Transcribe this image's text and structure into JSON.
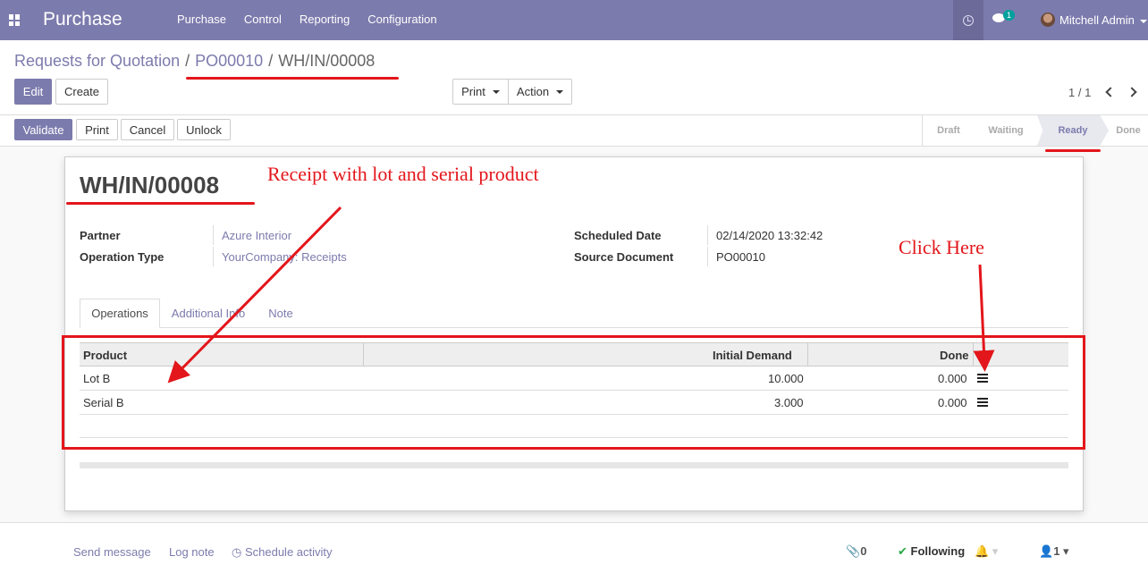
{
  "navbar": {
    "app_name": "Purchase",
    "menu": [
      "Purchase",
      "Control",
      "Reporting",
      "Configuration"
    ],
    "chat_count": "1",
    "user_name": "Mitchell Admin"
  },
  "breadcrumb": {
    "root": "Requests for Quotation",
    "parent": "PO00010",
    "current": "WH/IN/00008"
  },
  "toolbar": {
    "edit": "Edit",
    "create": "Create",
    "print": "Print",
    "action": "Action",
    "pager": "1 / 1"
  },
  "actions": {
    "validate": "Validate",
    "print": "Print",
    "cancel": "Cancel",
    "unlock": "Unlock"
  },
  "stages": [
    "Draft",
    "Waiting",
    "Ready",
    "Done"
  ],
  "current_stage": "Ready",
  "record": {
    "name": "WH/IN/00008",
    "partner_label": "Partner",
    "partner": "Azure Interior",
    "operation_type_label": "Operation Type",
    "operation_type": "YourCompany: Receipts",
    "scheduled_date_label": "Scheduled Date",
    "scheduled_date": "02/14/2020 13:32:42",
    "source_document_label": "Source Document",
    "source_document": "PO00010"
  },
  "tabs": [
    "Operations",
    "Additional Info",
    "Note"
  ],
  "table": {
    "headers": {
      "product": "Product",
      "initial_demand": "Initial Demand",
      "done": "Done"
    },
    "rows": [
      {
        "product": "Lot B",
        "initial_demand": "10.000",
        "done": "0.000"
      },
      {
        "product": "Serial B",
        "initial_demand": "3.000",
        "done": "0.000"
      }
    ]
  },
  "chatter": {
    "send_message": "Send message",
    "log_note": "Log note",
    "schedule_activity": "Schedule activity",
    "attachments": "0",
    "following": "Following",
    "followers": "1"
  },
  "annotations": {
    "receipt_note": "Receipt with lot and serial product",
    "click_here": "Click Here"
  },
  "colors": {
    "brand": "#7c7bad",
    "annotation": "#e3161b"
  }
}
